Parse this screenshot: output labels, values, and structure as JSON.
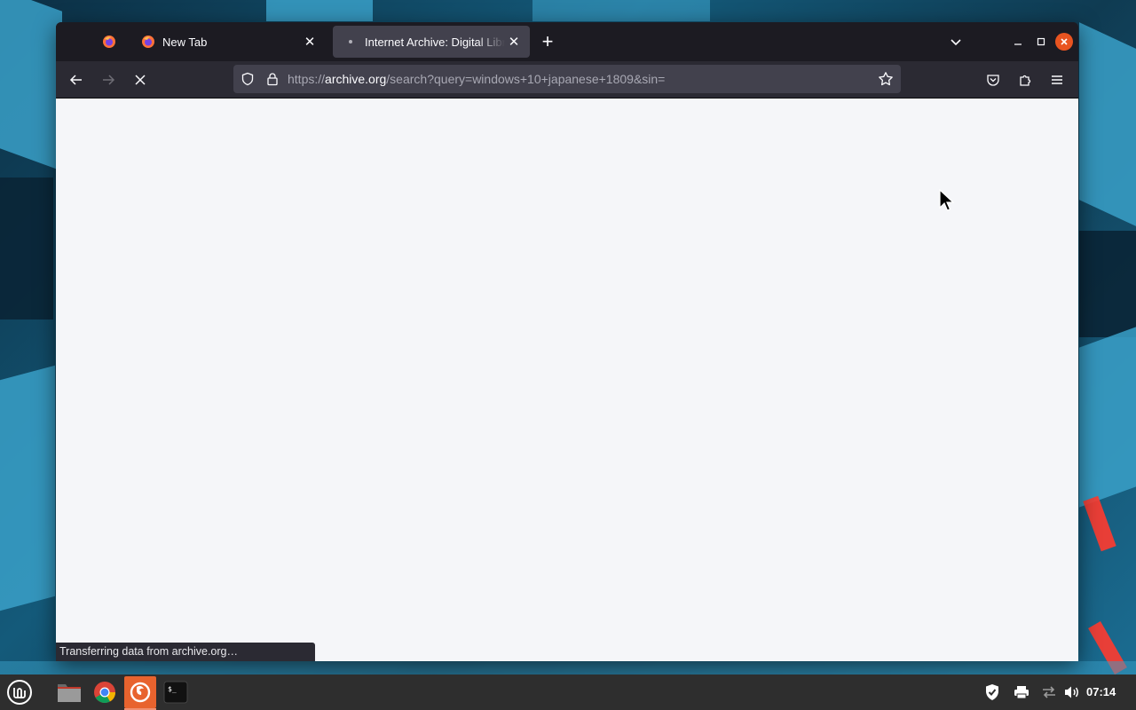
{
  "browser": {
    "tabs": [
      {
        "title": "New Tab",
        "favicon": "firefox-icon",
        "active": false
      },
      {
        "title": "Internet Archive: Digital Library of Free & Borrowable Books",
        "favicon": "loading-dot-icon",
        "active": true
      }
    ],
    "url": {
      "scheme": "https://",
      "host": "archive.org",
      "path": "/search?query=windows+10+japanese+1809&sin="
    },
    "status_text": "Transferring data from archive.org…"
  },
  "taskbar": {
    "apps": [
      "menu-icon",
      "files-icon",
      "chrome-icon",
      "firefox-icon",
      "terminal-icon"
    ],
    "clock": "07:14"
  },
  "colors": {
    "accent": "#e95420",
    "tab_bar": "#1c1b22",
    "toolbar": "#2b2a33",
    "content_bg": "#f5f6f9"
  }
}
